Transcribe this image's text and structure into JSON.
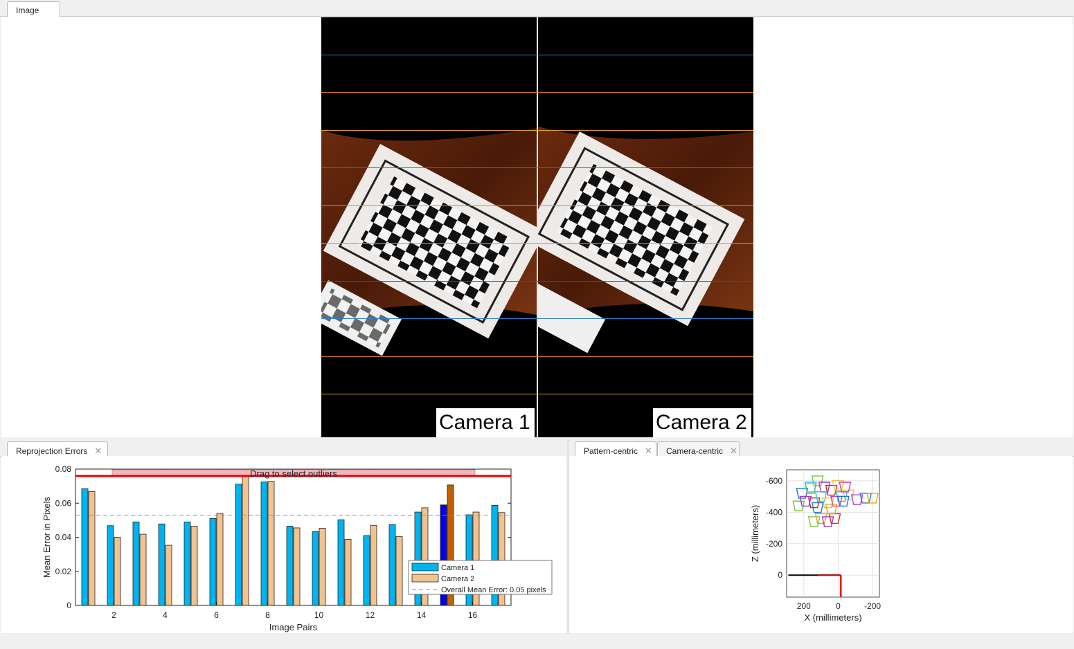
{
  "top_tabs": [
    {
      "label": "Image",
      "active": true
    }
  ],
  "image_view": {
    "camera1_label": "Camera 1",
    "camera2_label": "Camera 2",
    "epipolar_line_colors": [
      "#2e7fd0",
      "#d97a1c",
      "#e0a020",
      "#9b3bb5",
      "#7fb83a",
      "#4fb6e6",
      "#b82020",
      "#2e7fd0",
      "#d97a1c",
      "#e0a020"
    ]
  },
  "bottom_left_tabs": [
    {
      "label": "Reprojection Errors",
      "active": true,
      "closable": true
    }
  ],
  "bottom_right_tabs": [
    {
      "label": "Pattern-centric",
      "active": true,
      "closable": true
    },
    {
      "label": "Camera-centric",
      "active": false,
      "closable": true
    }
  ],
  "chart_data": [
    {
      "type": "bar",
      "xlabel": "Image Pairs",
      "ylabel": "Mean Error in Pixels",
      "ylim": [
        0,
        0.08
      ],
      "yticks": [
        "0",
        "0.02",
        "0.04",
        "0.06",
        "0.08"
      ],
      "xticks": [
        "2",
        "4",
        "6",
        "8",
        "10",
        "12",
        "14",
        "16"
      ],
      "categories": [
        1,
        2,
        3,
        4,
        5,
        6,
        7,
        8,
        9,
        10,
        11,
        12,
        13,
        14,
        15,
        16,
        17
      ],
      "series": [
        {
          "name": "Camera 1",
          "color": "#00b4f0",
          "values": [
            0.0685,
            0.0468,
            0.049,
            0.0478,
            0.049,
            0.051,
            0.0712,
            0.0725,
            0.0465,
            0.0433,
            0.0503,
            0.041,
            0.0475,
            0.0548,
            0.059,
            0.0532,
            0.0587
          ]
        },
        {
          "name": "Camera 2",
          "color": "#f2c28f",
          "values": [
            0.0668,
            0.04,
            0.0418,
            0.0353,
            0.0465,
            0.054,
            0.076,
            0.0728,
            0.0455,
            0.0453,
            0.0388,
            0.047,
            0.0405,
            0.0573,
            0.0707,
            0.0548,
            0.0545
          ]
        }
      ],
      "selected_index": 15,
      "selected_colors": {
        "Camera 1": "#0000ee",
        "Camera 2": "#c06000"
      },
      "overall_mean_error": 0.053,
      "overall_mean_label": "Overall Mean Error: 0.05 pixels",
      "outlier_threshold": 0.076,
      "drag_label": "Drag to select outliers",
      "legend_position": "bottom-right"
    },
    {
      "type": "scatter",
      "xlabel": "X (millimeters)",
      "ylabel": "Z (millimeters)",
      "xticks": [
        "200",
        "0",
        "-200"
      ],
      "yticks": [
        "-600",
        "-400",
        "-200",
        "0"
      ],
      "xlim": [
        300,
        -240
      ],
      "ylim": [
        -670,
        140
      ],
      "grid": true
    }
  ]
}
